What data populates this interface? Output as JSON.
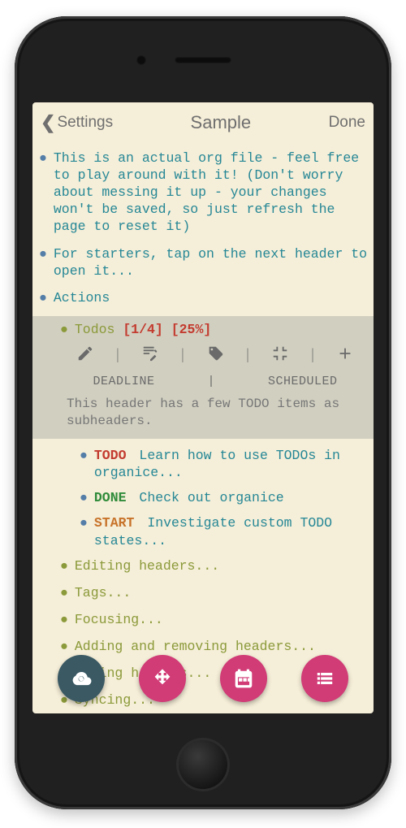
{
  "nav": {
    "back_label": "Settings",
    "title": "Sample",
    "done": "Done"
  },
  "headers": {
    "h1": "This is an actual org file - feel free to play around with it! (Don't worry about messing it up - your changes won't be saved, so just refresh the page to reset it)",
    "h2": "For starters, tap on the next header to open it...",
    "h3": "Actions",
    "todos_label": "Todos ",
    "stat_frac": "[1/4]",
    "stat_pct": "[25%]",
    "body": "This header has a few TODO items as subheaders.",
    "sub_editing": "Editing headers...",
    "sub_tags": "Tags...",
    "sub_focusing": "Focusing...",
    "sub_adding": "Adding and removing headers...",
    "sub_moving": "Moving headers...",
    "sub_syncing": "Syncing..."
  },
  "todos": {
    "t1_kw": "TODO",
    "t1_text": "Learn how to use TODOs in organice...",
    "t2_kw": "DONE",
    "t2_text": "Check out organice",
    "t3_kw": "START",
    "t3_text": "Investigate custom TODO states..."
  },
  "toolbar": {
    "deadline": "DEADLINE",
    "scheduled": "SCHEDULED"
  }
}
